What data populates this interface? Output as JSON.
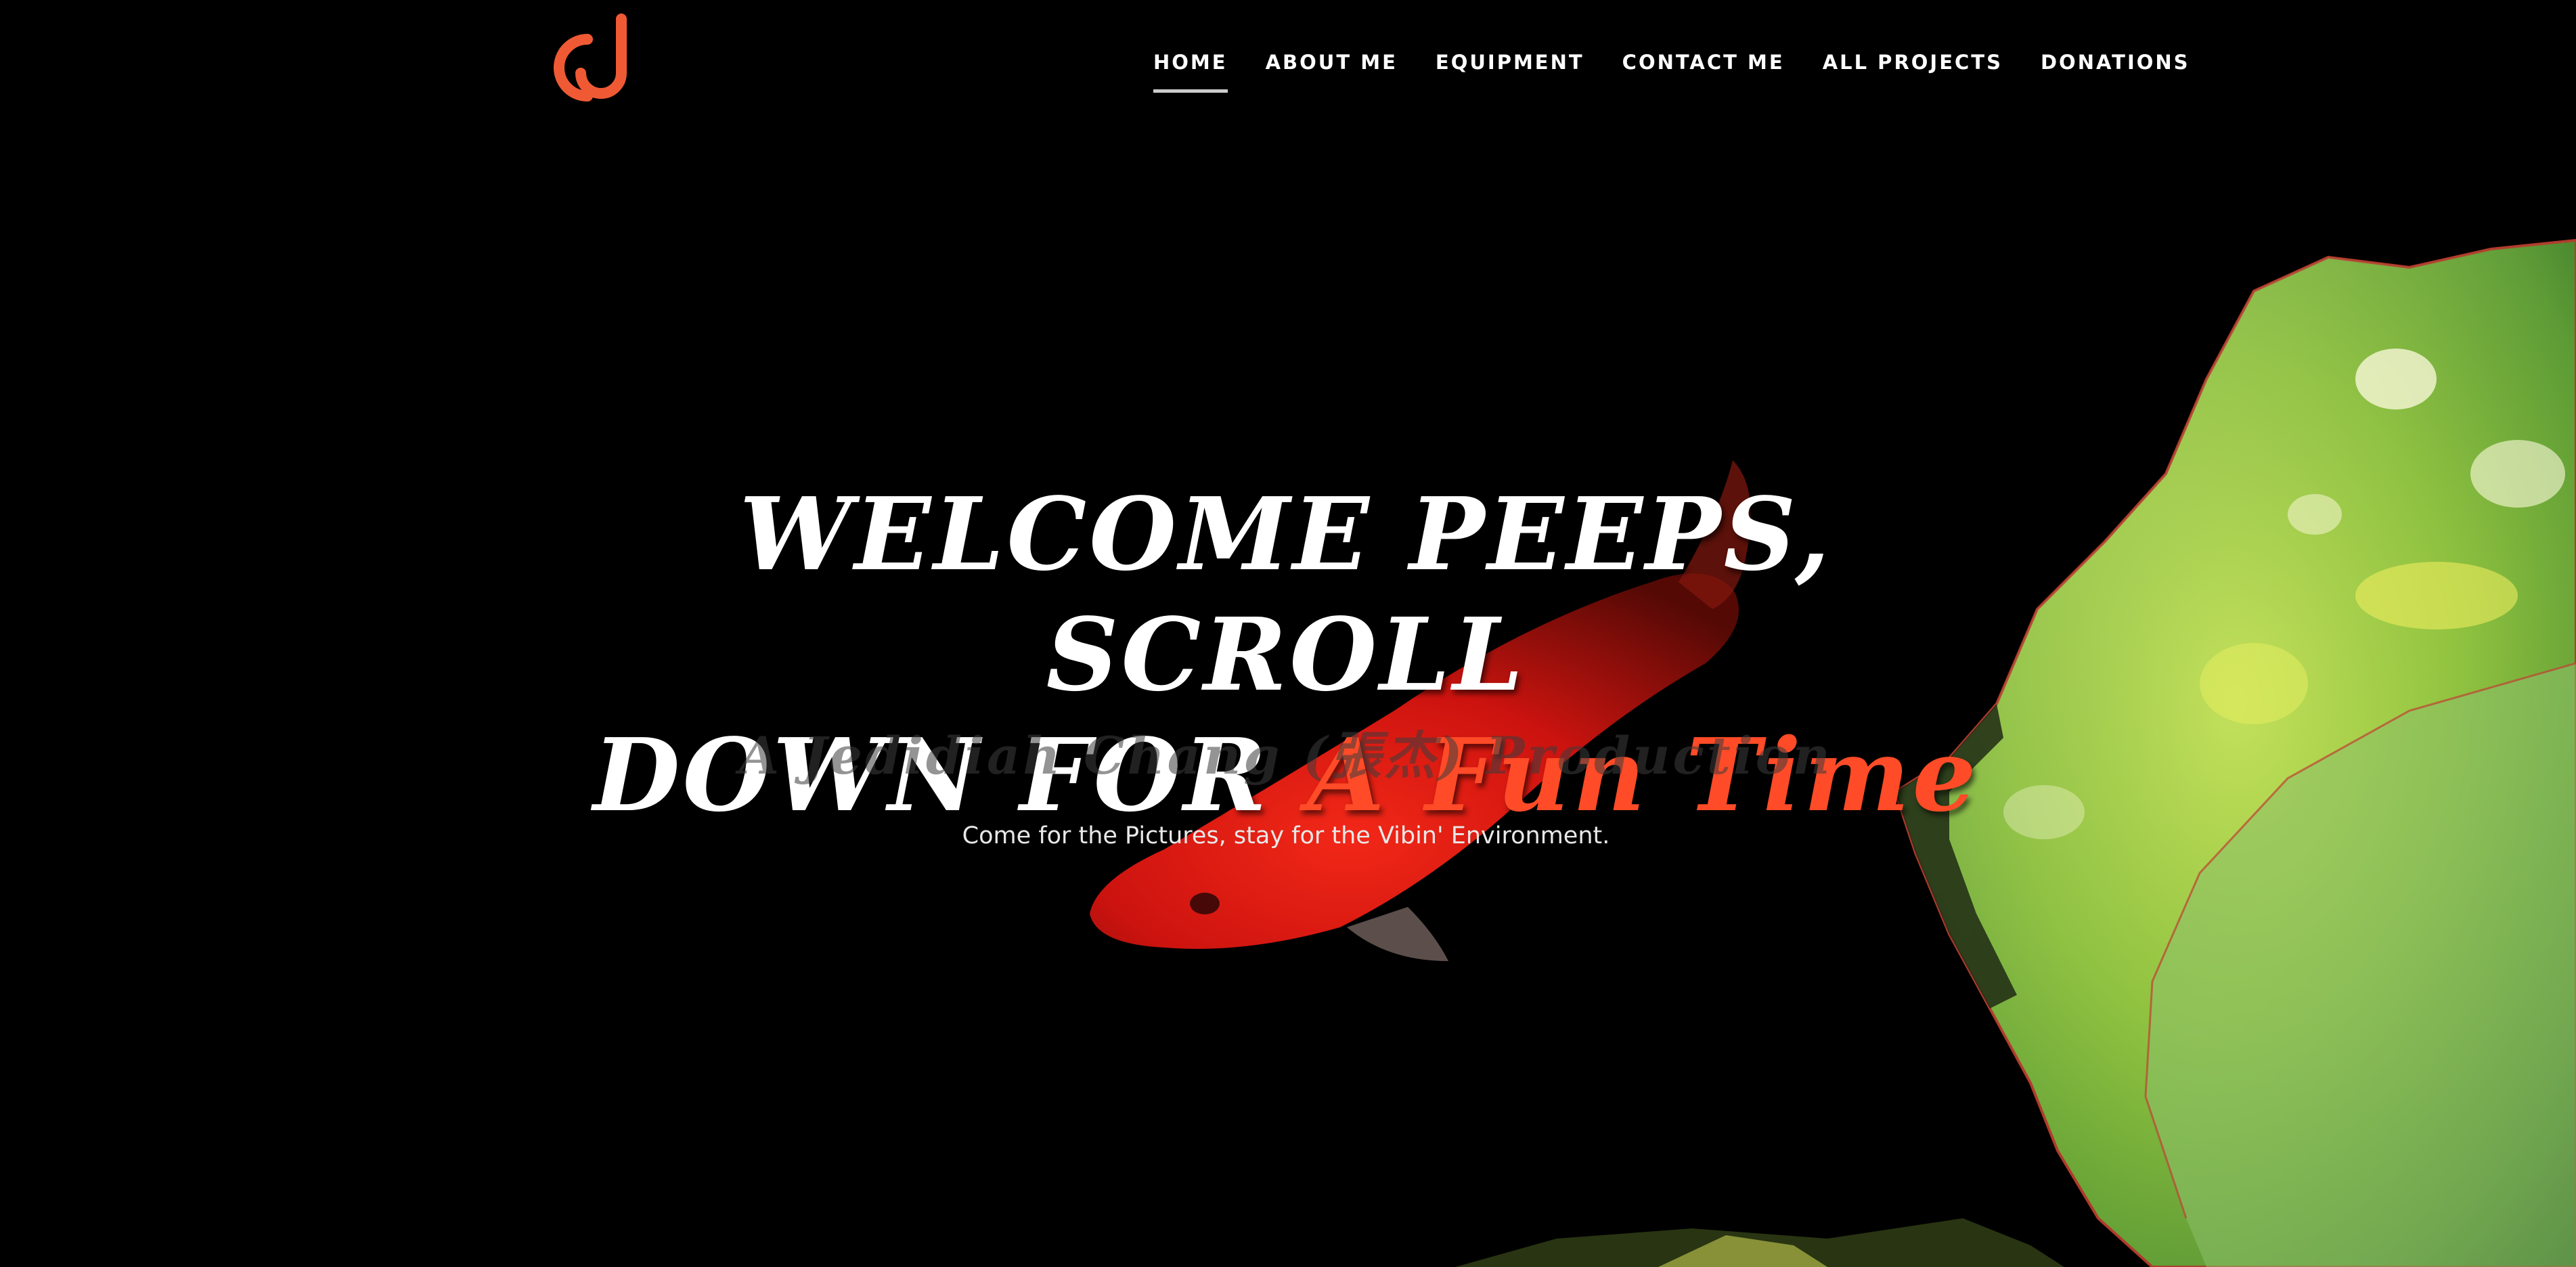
{
  "nav": {
    "items": [
      {
        "label": "HOME",
        "active": true
      },
      {
        "label": "ABOUT ME"
      },
      {
        "label": "EQUIPMENT"
      },
      {
        "label": "CONTACT ME"
      },
      {
        "label": "ALL PROJECTS"
      },
      {
        "label": "DONATIONS"
      }
    ]
  },
  "hero": {
    "title_line1": "WELCOME PEEPS, SCROLL",
    "title_line2_prefix": "DOWN FOR ",
    "title_line2_accent": "A Fun Time",
    "subtitle": "A Jedidiah Chang (張杰) Production",
    "tagline": "Come for the Pictures, stay for the Vibin' Environment."
  },
  "colors": {
    "background": "#000000",
    "accent": "#ff4b27",
    "text": "#ffffff"
  },
  "icons": {
    "logo": "cj-monogram-logo"
  }
}
